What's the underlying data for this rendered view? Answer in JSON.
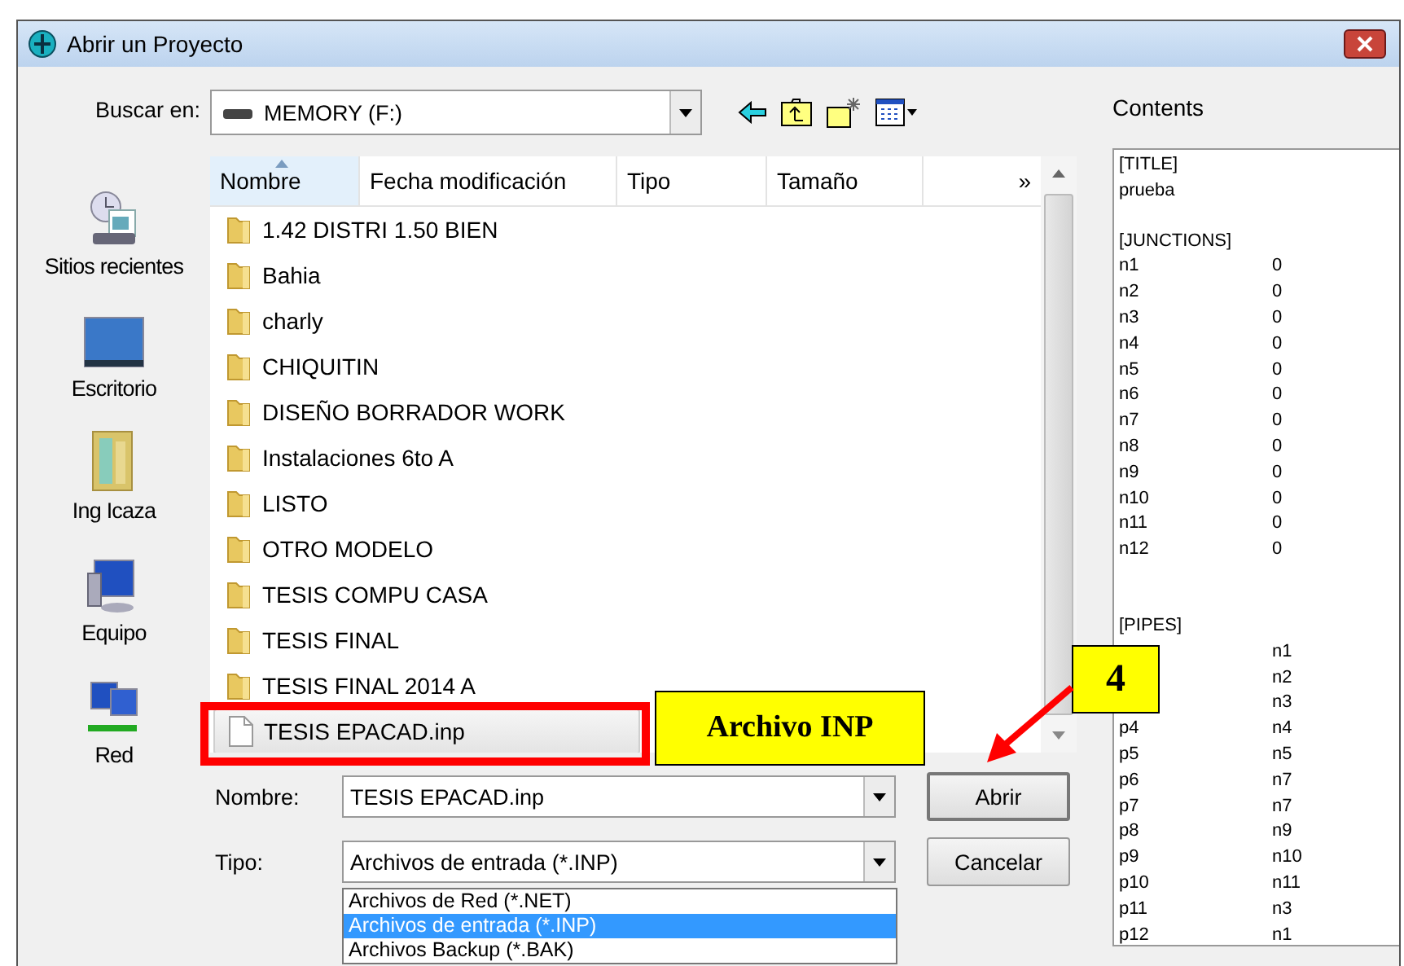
{
  "window": {
    "title": "Abrir un Proyecto"
  },
  "look_in": {
    "label": "Buscar en:",
    "value": "MEMORY (F:)"
  },
  "places": [
    {
      "label": "Sitios recientes",
      "kind": "recent"
    },
    {
      "label": "Escritorio",
      "kind": "desktop"
    },
    {
      "label": "Ing Icaza",
      "kind": "user"
    },
    {
      "label": "Equipo",
      "kind": "computer"
    },
    {
      "label": "Red",
      "kind": "network"
    }
  ],
  "file_list": {
    "columns": [
      {
        "label": "Nombre",
        "sorted": true
      },
      {
        "label": "Fecha modificación",
        "sorted": false
      },
      {
        "label": "Tipo",
        "sorted": false
      },
      {
        "label": "Tamaño",
        "sorted": false
      },
      {
        "label": "»",
        "sorted": false
      }
    ],
    "items": [
      {
        "name": "1.42 DISTRI 1.50 BIEN",
        "kind": "folder",
        "selected": false
      },
      {
        "name": "Bahia",
        "kind": "folder",
        "selected": false
      },
      {
        "name": "charly",
        "kind": "folder",
        "selected": false
      },
      {
        "name": "CHIQUITIN",
        "kind": "folder",
        "selected": false
      },
      {
        "name": "DISEÑO BORRADOR WORK",
        "kind": "folder",
        "selected": false
      },
      {
        "name": "Instalaciones 6to A",
        "kind": "folder",
        "selected": false
      },
      {
        "name": "LISTO",
        "kind": "folder",
        "selected": false
      },
      {
        "name": "OTRO MODELO",
        "kind": "folder",
        "selected": false
      },
      {
        "name": "TESIS COMPU CASA",
        "kind": "folder",
        "selected": false
      },
      {
        "name": "TESIS FINAL",
        "kind": "folder",
        "selected": false
      },
      {
        "name": "TESIS FINAL 2014 A",
        "kind": "folder",
        "selected": false
      },
      {
        "name": "TESIS EPACAD.inp",
        "kind": "file",
        "selected": true
      }
    ]
  },
  "file_name": {
    "label": "Nombre:",
    "value": "TESIS EPACAD.inp"
  },
  "file_type": {
    "label": "Tipo:",
    "value": "Archivos de entrada (*.INP)",
    "options": [
      {
        "label": "Archivos de Red (*.NET)",
        "selected": false
      },
      {
        "label": "Archivos de entrada (*.INP)",
        "selected": true
      },
      {
        "label": "Archivos Backup (*.BAK)",
        "selected": false
      }
    ]
  },
  "buttons": [
    {
      "label": "Abrir",
      "default": true
    },
    {
      "label": "Cancelar",
      "default": false
    }
  ],
  "contents": {
    "label": "Contents",
    "sections": [
      {
        "header": "[TITLE]",
        "rows": [
          {
            "id": "prueba"
          }
        ]
      },
      {
        "header": "[JUNCTIONS]",
        "rows": [
          {
            "id": "n1",
            "value": "0"
          },
          {
            "id": "n2",
            "value": "0"
          },
          {
            "id": "n3",
            "value": "0"
          },
          {
            "id": "n4",
            "value": "0"
          },
          {
            "id": "n5",
            "value": "0"
          },
          {
            "id": "n6",
            "value": "0"
          },
          {
            "id": "n7",
            "value": "0"
          },
          {
            "id": "n8",
            "value": "0"
          },
          {
            "id": "n9",
            "value": "0"
          },
          {
            "id": "n10",
            "value": "0"
          },
          {
            "id": "n11",
            "value": "0"
          },
          {
            "id": "n12",
            "value": "0"
          }
        ]
      },
      {
        "header": "[PIPES]",
        "rows": [
          {
            "value": "n1"
          },
          {
            "value": "n2"
          },
          {
            "value": "n3"
          },
          {
            "id": "p4",
            "value": "n4"
          },
          {
            "id": "p5",
            "value": "n5"
          },
          {
            "id": "p6",
            "value": "n7"
          },
          {
            "id": "p7",
            "value": "n7"
          },
          {
            "id": "p8",
            "value": "n9"
          },
          {
            "id": "p9",
            "value": "n10"
          },
          {
            "id": "p10",
            "value": "n11"
          },
          {
            "id": "p11",
            "value": "n3"
          },
          {
            "id": "p12",
            "value": "n1"
          }
        ]
      }
    ]
  },
  "annotations": [
    {
      "kind": "label",
      "text": "Archivo INP"
    },
    {
      "kind": "step",
      "text": "4"
    }
  ]
}
